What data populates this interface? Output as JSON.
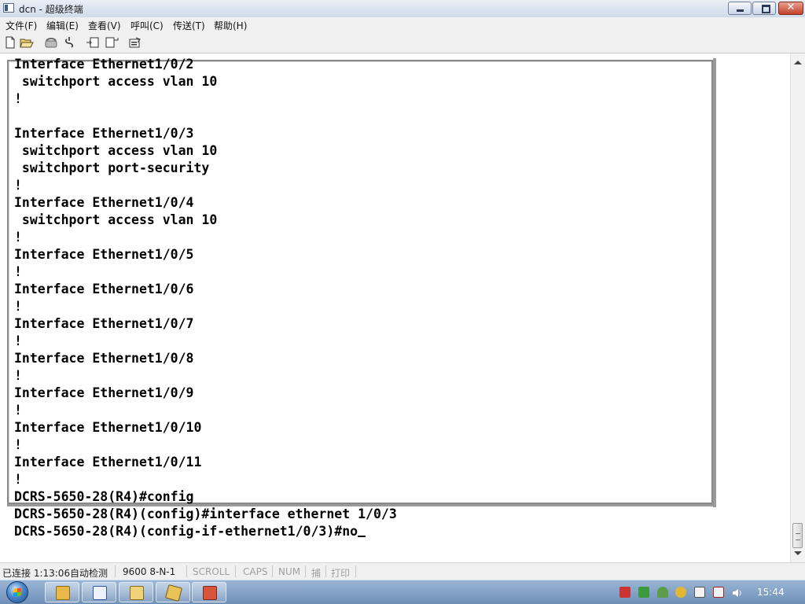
{
  "window": {
    "title": "dcn - 超级终端"
  },
  "menu": [
    "文件(F)",
    "编辑(E)",
    "查看(V)",
    "呼叫(C)",
    "传送(T)",
    "帮助(H)"
  ],
  "toolbar": [
    "new-connection",
    "open",
    "dial",
    "disconnect",
    "send",
    "receive",
    "properties"
  ],
  "terminal": {
    "lines": [
      "Interface Ethernet1/0/2",
      " switchport access vlan 10",
      "!",
      "",
      "Interface Ethernet1/0/3",
      " switchport access vlan 10",
      " switchport port-security",
      "!",
      "Interface Ethernet1/0/4",
      " switchport access vlan 10",
      "!",
      "Interface Ethernet1/0/5",
      "!",
      "Interface Ethernet1/0/6",
      "!",
      "Interface Ethernet1/0/7",
      "!",
      "Interface Ethernet1/0/8",
      "!",
      "Interface Ethernet1/0/9",
      "!",
      "Interface Ethernet1/0/10",
      "!",
      "Interface Ethernet1/0/11",
      "!",
      "DCRS-5650-28(R4)#config",
      "DCRS-5650-28(R4)(config)#interface ethernet 1/0/3",
      "DCRS-5650-28(R4)(config-if-ethernet1/0/3)#no"
    ]
  },
  "status": {
    "connected": "已连接 1:13:06",
    "detect": "自动检测",
    "port_settings": "9600 8-N-1",
    "scroll": "SCROLL",
    "caps": "CAPS",
    "num": "NUM",
    "capture": "捕",
    "print": "打印"
  },
  "taskbar": {
    "clock": "15:44",
    "apps": [
      "explorer",
      "word",
      "folder",
      "packages",
      "presentation"
    ]
  }
}
